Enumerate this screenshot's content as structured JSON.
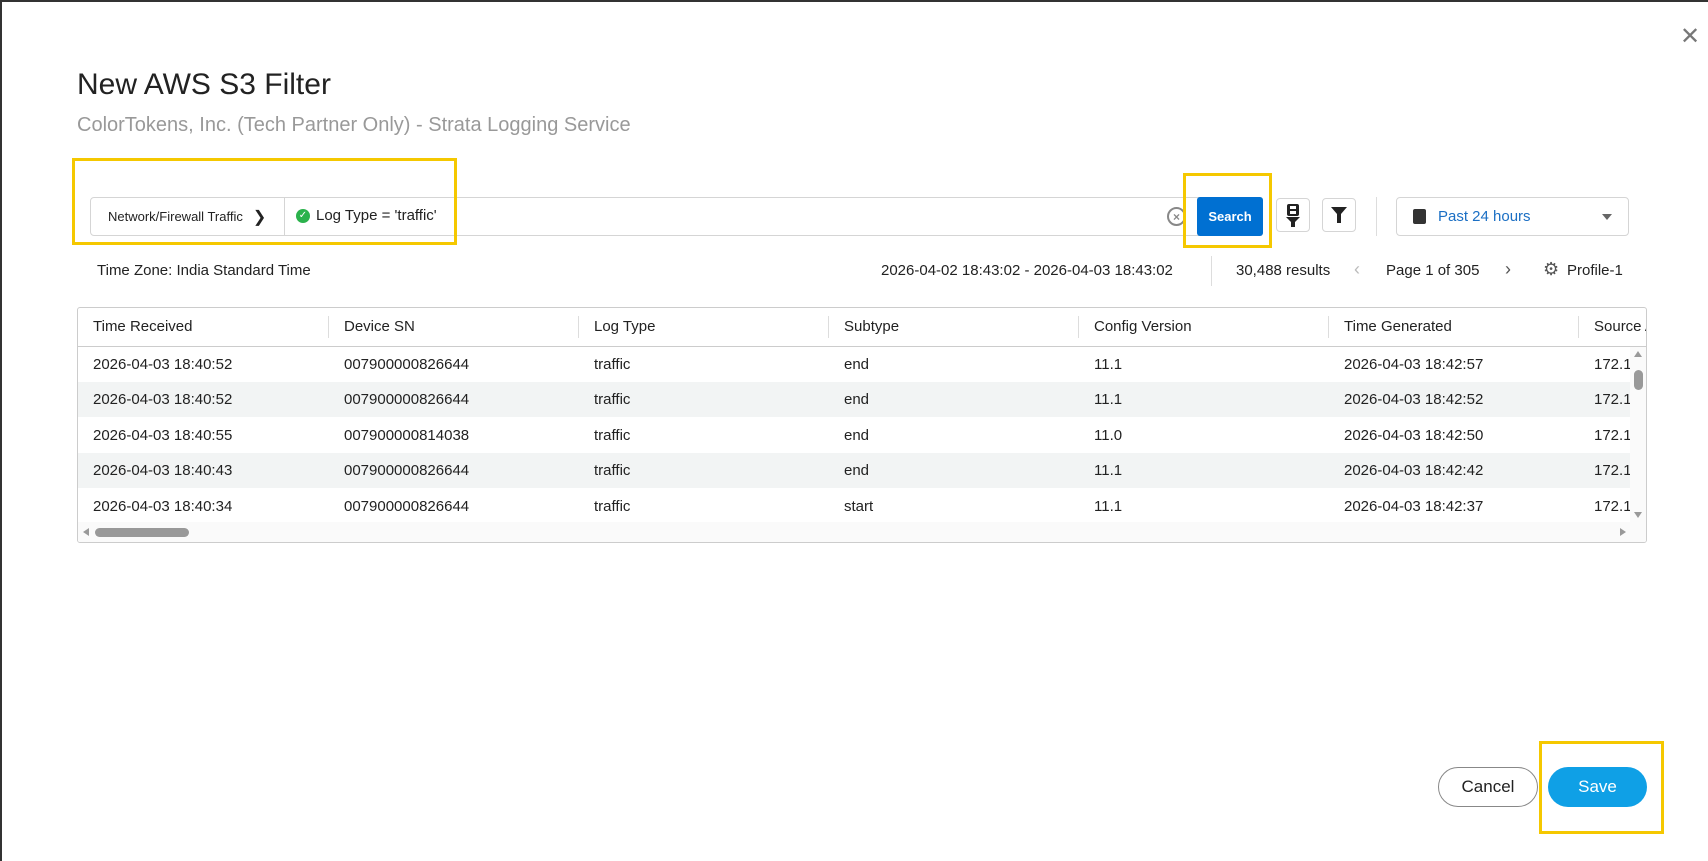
{
  "dialog": {
    "title": "New AWS S3 Filter",
    "subtitle": "ColorTokens, Inc. (Tech Partner Only) - Strata Logging Service",
    "close_icon": "close-icon"
  },
  "query_bar": {
    "log_source": "Network/Firewall Traffic",
    "query": "Log Type = 'traffic'",
    "search_label": "Search",
    "time_range": "Past 24 hours"
  },
  "meta": {
    "time_zone": "Time Zone: India Standard Time",
    "date_range": "2026-04-02 18:43:02 - 2026-04-03 18:43:02",
    "results": "30,488 results",
    "page": "Page 1 of 305",
    "profile": "Profile-1"
  },
  "table": {
    "columns": [
      "Time Received",
      "Device SN",
      "Log Type",
      "Subtype",
      "Config Version",
      "Time Generated",
      "Source A"
    ],
    "rows": [
      [
        "2026-04-03 18:40:52",
        "007900000826644",
        "traffic",
        "end",
        "11.1",
        "2026-04-03 18:42:57",
        "172.1"
      ],
      [
        "2026-04-03 18:40:52",
        "007900000826644",
        "traffic",
        "end",
        "11.1",
        "2026-04-03 18:42:52",
        "172.1"
      ],
      [
        "2026-04-03 18:40:55",
        "007900000814038",
        "traffic",
        "end",
        "11.0",
        "2026-04-03 18:42:50",
        "172.1"
      ],
      [
        "2026-04-03 18:40:43",
        "007900000826644",
        "traffic",
        "end",
        "11.1",
        "2026-04-03 18:42:42",
        "172.1"
      ],
      [
        "2026-04-03 18:40:34",
        "007900000826644",
        "traffic",
        "start",
        "11.1",
        "2026-04-03 18:42:37",
        "172.1"
      ]
    ]
  },
  "footer": {
    "cancel_label": "Cancel",
    "save_label": "Save"
  },
  "colors": {
    "search": "#0070d2",
    "save": "#0fa0e6",
    "highlight": "#f5c800",
    "link": "#1b6fc4"
  }
}
